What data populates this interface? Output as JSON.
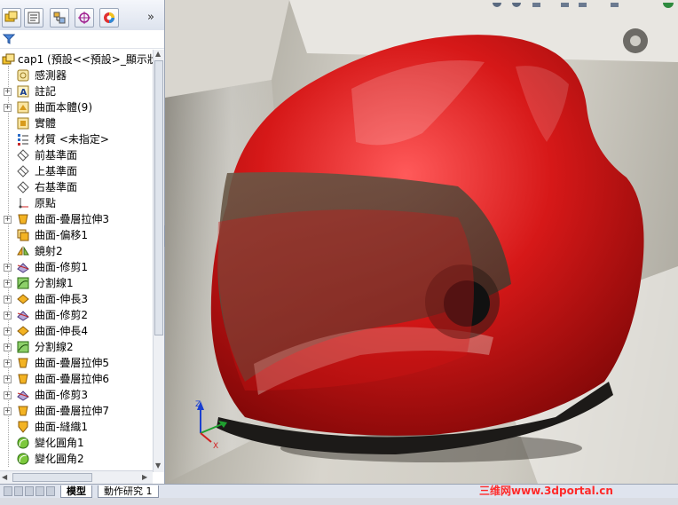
{
  "panel": {
    "tabs": [
      {
        "name": "featuremanager-tab-icon"
      },
      {
        "name": "propertymanager-tab-icon"
      },
      {
        "name": "configurationmanager-tab-icon"
      },
      {
        "name": "dimxpert-tab-icon"
      },
      {
        "name": "display-manager-tab-icon"
      }
    ],
    "more": "»"
  },
  "tree": {
    "root": "cap1 (預設<<預設>_顯示狀",
    "items": [
      {
        "label": "感測器",
        "icon": "sensor-icon",
        "expand": false
      },
      {
        "label": "註記",
        "icon": "annotation-icon",
        "expand": true
      },
      {
        "label": "曲面本體(9)",
        "icon": "surface-bodies-icon",
        "expand": true
      },
      {
        "label": "實體",
        "icon": "solid-bodies-icon",
        "expand": false
      },
      {
        "label": "材質 <未指定>",
        "icon": "material-icon",
        "expand": false
      },
      {
        "label": "前基準面",
        "icon": "plane-icon",
        "expand": false
      },
      {
        "label": "上基準面",
        "icon": "plane-icon",
        "expand": false
      },
      {
        "label": "右基準面",
        "icon": "plane-icon",
        "expand": false
      },
      {
        "label": "原點",
        "icon": "origin-icon",
        "expand": false
      },
      {
        "label": "曲面-疊層拉伸3",
        "icon": "loft-surface-icon",
        "expand": true
      },
      {
        "label": "曲面-偏移1",
        "icon": "offset-surface-icon",
        "expand": false
      },
      {
        "label": "鏡射2",
        "icon": "mirror-icon",
        "expand": false
      },
      {
        "label": "曲面-修剪1",
        "icon": "trim-surface-icon",
        "expand": true
      },
      {
        "label": "分割線1",
        "icon": "split-line-icon",
        "expand": true
      },
      {
        "label": "曲面-伸長3",
        "icon": "extend-surface-icon",
        "expand": true
      },
      {
        "label": "曲面-修剪2",
        "icon": "trim-surface-icon",
        "expand": true
      },
      {
        "label": "曲面-伸長4",
        "icon": "extend-surface-icon",
        "expand": true
      },
      {
        "label": "分割線2",
        "icon": "split-line-icon",
        "expand": true
      },
      {
        "label": "曲面-疊層拉伸5",
        "icon": "loft-surface-icon",
        "expand": true
      },
      {
        "label": "曲面-疊層拉伸6",
        "icon": "loft-surface-icon",
        "expand": true
      },
      {
        "label": "曲面-修剪3",
        "icon": "trim-surface-icon",
        "expand": true
      },
      {
        "label": "曲面-疊層拉伸7",
        "icon": "loft-surface-icon",
        "expand": true
      },
      {
        "label": "曲面-縫織1",
        "icon": "knit-surface-icon",
        "expand": false
      },
      {
        "label": "變化圓角1",
        "icon": "variable-fillet-icon",
        "expand": false
      },
      {
        "label": "變化圓角2",
        "icon": "variable-fillet-icon",
        "expand": false
      }
    ]
  },
  "bottom_tabs": [
    "模型",
    "動作研究 1"
  ],
  "watermark": "三维网www.3dportal.cn",
  "colors": {
    "helmet": "#d01414",
    "visor": "#5a4a3c"
  }
}
